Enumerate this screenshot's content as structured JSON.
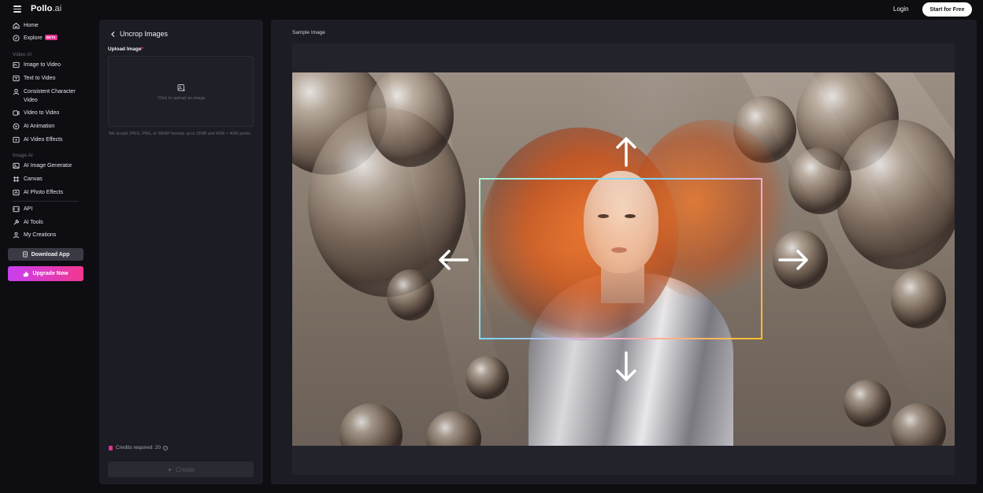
{
  "header": {
    "logo_main": "Pollo",
    "logo_suffix": ".ai",
    "login_label": "Login",
    "start_label": "Start for Free"
  },
  "sidebar": {
    "home": "Home",
    "explore": "Explore",
    "explore_badge": "BETA",
    "section_video": "Video AI",
    "image_to_video": "Image to Video",
    "text_to_video": "Text to Video",
    "consistent_character": "Consistent Character Video",
    "video_to_video": "Video to Video",
    "ai_animation": "AI Animation",
    "ai_video_effects": "AI Video Effects",
    "section_image": "Image AI",
    "ai_image_generator": "AI Image Generator",
    "canvas": "Canvas",
    "ai_photo_effects": "AI Photo Effects",
    "api": "API",
    "ai_tools": "AI Tools",
    "my_creations": "My Creations",
    "download_app": "Download App",
    "upgrade_now": "Upgrade Now"
  },
  "tool_panel": {
    "title": "Uncrop Images",
    "upload_label": "Upload Image",
    "required_mark": "*",
    "upload_prompt": "Click to upload an image",
    "help_text": "We accept JPEG, PNG, or WEBP formats up to 15MB and 4096 × 4096 pixels.",
    "credits_text": "Credits required: 20",
    "create_label": "Create"
  },
  "preview": {
    "label": "Sample Image"
  },
  "colors": {
    "accent_pink": "#e0308f",
    "upgrade_gradient_start": "#c93ef0",
    "upgrade_gradient_end": "#f2388f",
    "panel_bg": "#1c1c24",
    "page_bg": "#0d0d12"
  }
}
